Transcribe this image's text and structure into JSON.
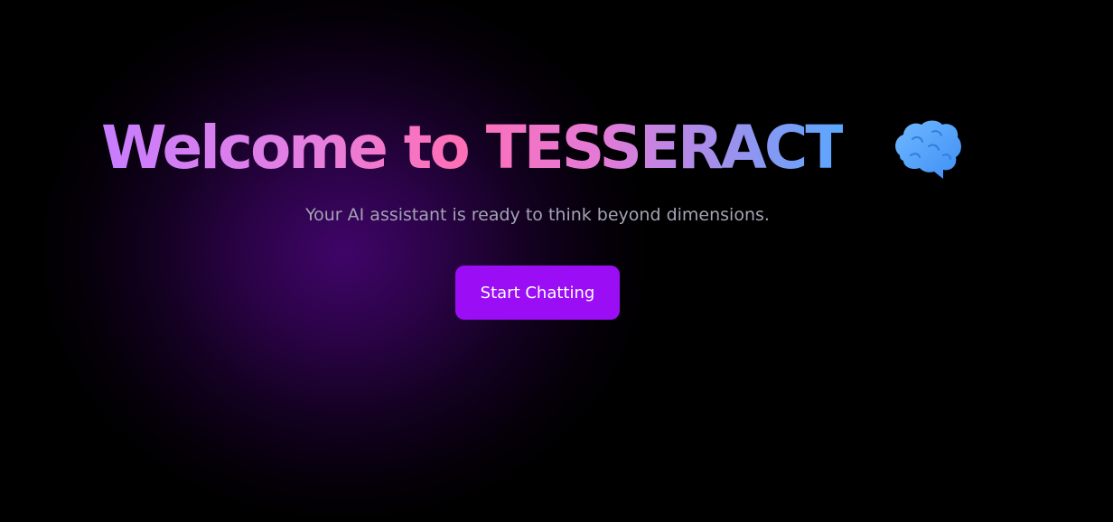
{
  "hero": {
    "title_prefix": "Welcome to ",
    "title_brand": "TESSERACT",
    "icon": "brain-icon",
    "subtitle": "Your AI assistant is ready to think beyond dimensions."
  },
  "cta": {
    "label": "Start Chatting"
  },
  "colors": {
    "background": "#000000",
    "glow": "#3f0468",
    "accent_button": "#9a0df5",
    "title_gradient": [
      "#c77dff",
      "#ff6fb5",
      "#5aa7ff"
    ],
    "subtitle": "#a3a3b4"
  }
}
